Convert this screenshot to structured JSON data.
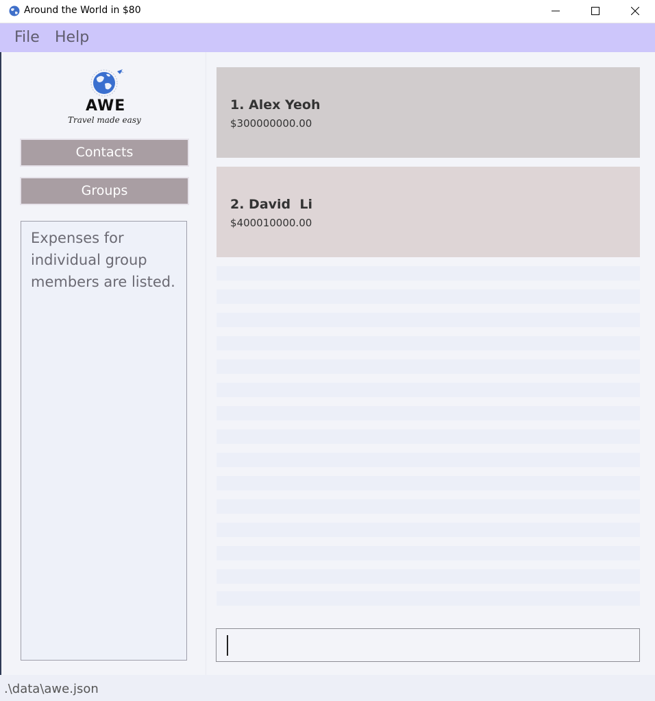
{
  "window": {
    "title": "Around the World in $80"
  },
  "menu": {
    "items": [
      {
        "label": "File"
      },
      {
        "label": "Help"
      }
    ]
  },
  "logo": {
    "name": "AWE",
    "tagline": "Travel made easy"
  },
  "nav": {
    "contacts_label": "Contacts",
    "groups_label": "Groups"
  },
  "description": "Expenses for individual group members are listed.",
  "expenses": [
    {
      "name": "1. Alex Yeoh",
      "amount": "$300000000.00",
      "color": "#d1cccd"
    },
    {
      "name": "2. David  Li",
      "amount": "$400010000.00",
      "color": "#ded5d6"
    }
  ],
  "command": {
    "value": ""
  },
  "status": {
    "path": ".\\data\\awe.json"
  },
  "colors": {
    "menubar": "#cdc6fb",
    "nav_button": "#a99ea3"
  }
}
